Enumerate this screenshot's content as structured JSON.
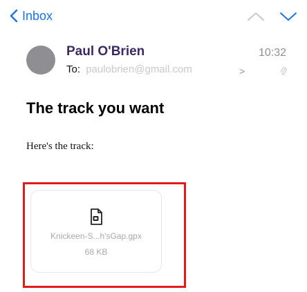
{
  "nav": {
    "back_label": "Inbox",
    "back_icon": "chevron-left-icon",
    "prev_icon": "chevron-up-icon",
    "next_icon": "chevron-down-icon"
  },
  "header": {
    "sender": "Paul O'Brien",
    "to_label": "To:",
    "to_address": "paulobrien@gmail.com",
    "details_chevron": ">",
    "time": "10:32",
    "attachment_indicator_icon": "paperclip-icon"
  },
  "message": {
    "subject": "The track you want",
    "body": "Here's the track:"
  },
  "attachment": {
    "file_name": "Knickeen-S...h'sGap.gpx",
    "file_size": "68 KB",
    "icon": "document-icon"
  },
  "colors": {
    "accent": "#1a73e8",
    "highlight": "#e01b1b",
    "sender": "#3b2a63",
    "avatar": "#8e8e93"
  }
}
